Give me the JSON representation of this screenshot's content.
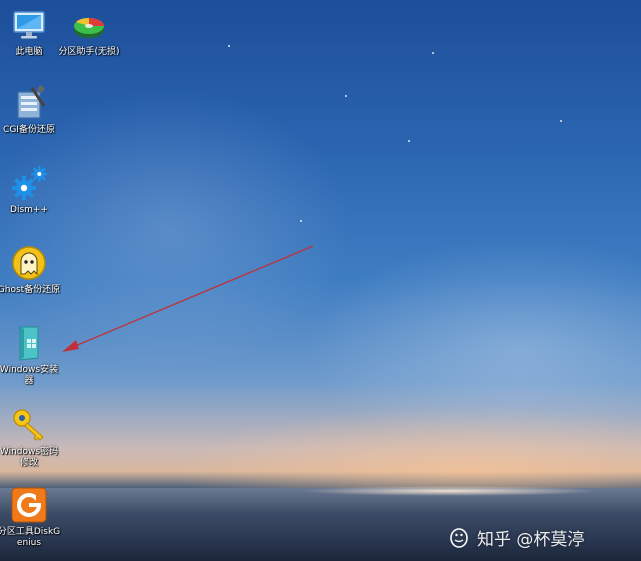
{
  "desktop": {
    "icons": [
      {
        "id": "this-pc",
        "label": "此电脑"
      },
      {
        "id": "partition-assistant",
        "label": "分区助手(无损)"
      },
      {
        "id": "cgi-backup",
        "label": "CGI备份还原"
      },
      {
        "id": "dism",
        "label": "Dism++"
      },
      {
        "id": "ghost-backup",
        "label": "Ghost备份还原"
      },
      {
        "id": "windows-installer",
        "label": "Windows安装器"
      },
      {
        "id": "windows-password",
        "label": "Windows密码修改"
      },
      {
        "id": "diskgenius",
        "label": "分区工具DiskGenius"
      }
    ]
  },
  "watermark": {
    "text": "知乎 @杯莫渟"
  },
  "colors": {
    "annotation_arrow": "#c0303a"
  }
}
